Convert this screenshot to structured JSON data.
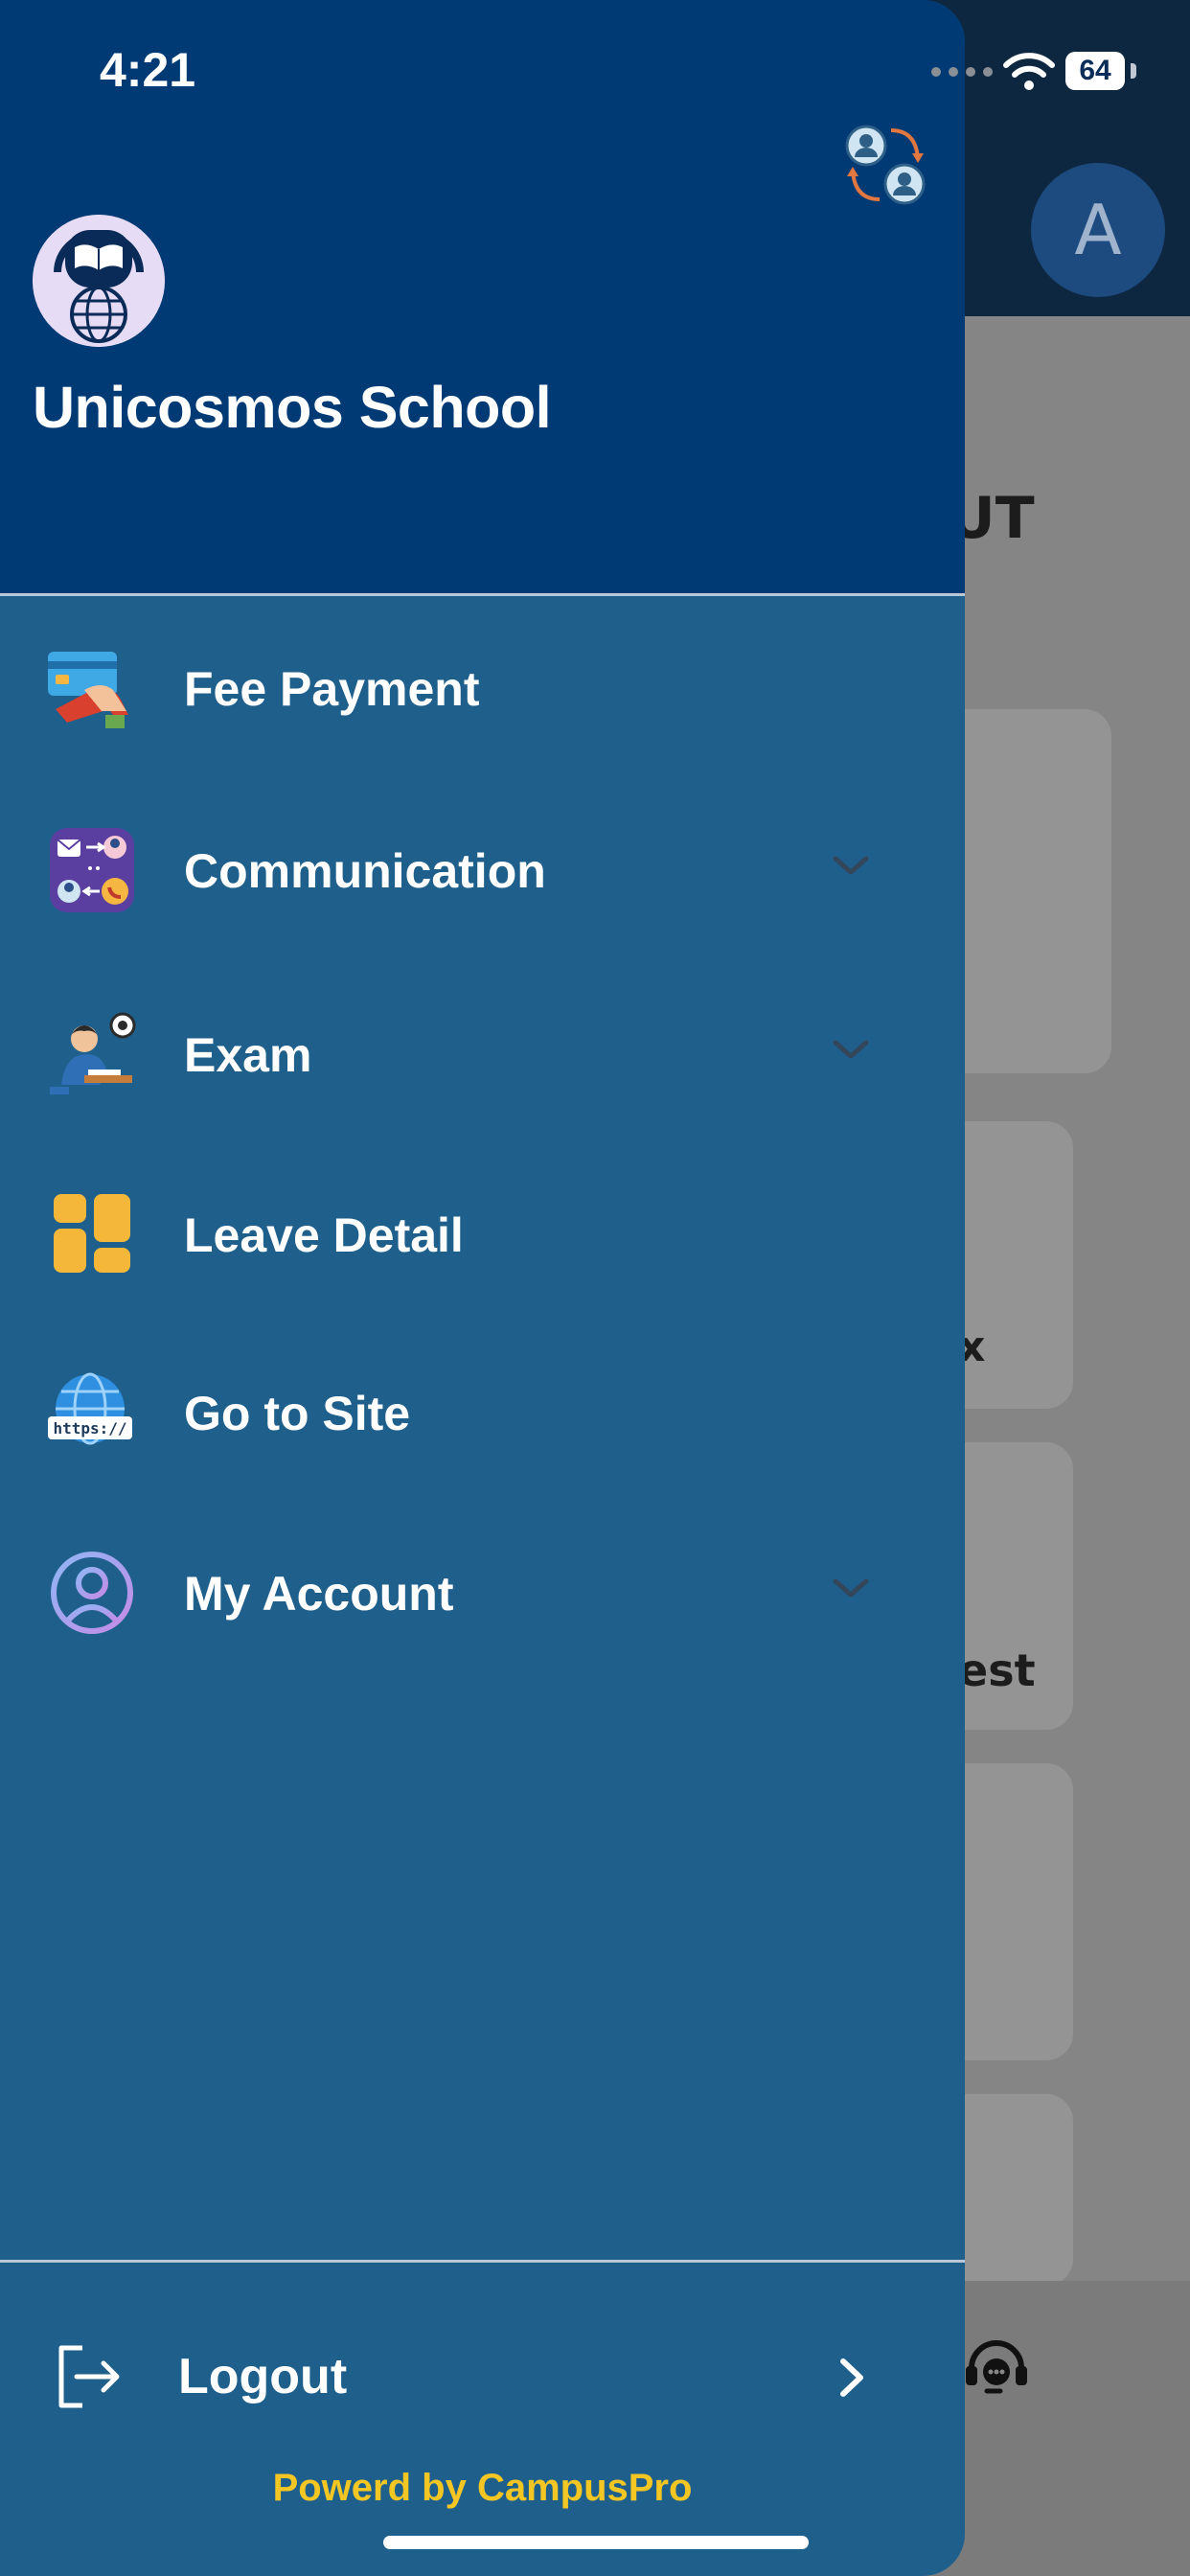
{
  "status_bar": {
    "time": "4:21",
    "battery": "64"
  },
  "background": {
    "avatar_letter": "A",
    "fragment_heading": "UT",
    "fragment_x": "x",
    "fragment_est": "est"
  },
  "drawer": {
    "school_name": "Unicosmos School",
    "menu": [
      {
        "label": "Fee Payment",
        "icon": "credit-card-icon",
        "expandable": false
      },
      {
        "label": "Communication",
        "icon": "communication-icon",
        "expandable": true
      },
      {
        "label": "Exam",
        "icon": "exam-icon",
        "expandable": true
      },
      {
        "label": "Leave Detail",
        "icon": "leave-detail-icon",
        "expandable": false
      },
      {
        "label": "Go to Site",
        "icon": "globe-https-icon",
        "expandable": false
      },
      {
        "label": "My Account",
        "icon": "account-icon",
        "expandable": true
      }
    ],
    "logout_label": "Logout",
    "powered_by": "Powerd by CampusPro"
  },
  "colors": {
    "drawer_header": "#003a75",
    "drawer_body": "#1f5f8b",
    "powered_text": "#f3c623"
  }
}
